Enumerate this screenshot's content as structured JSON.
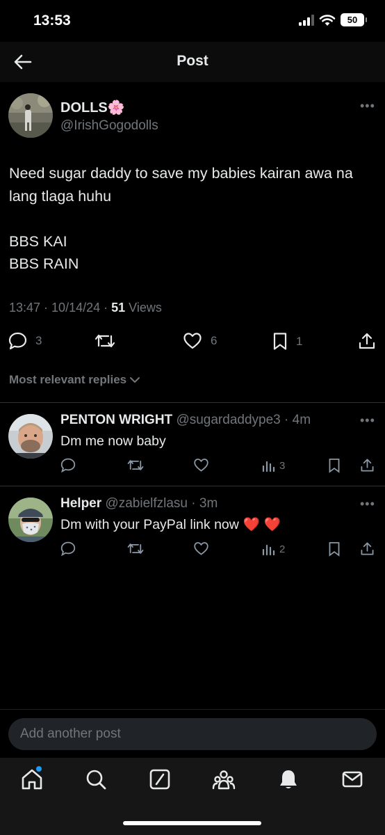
{
  "status_bar": {
    "time": "13:53",
    "battery": "50"
  },
  "header": {
    "title": "Post"
  },
  "post": {
    "author_name": "DOLLS",
    "author_emoji": "🌸",
    "author_handle": "@IrishGogodolls",
    "text": "Need sugar daddy to save my babies kairan awa na lang tlaga huhu\n\nBBS KAI\nBBS RAIN",
    "time": "13:47",
    "date": "10/14/24",
    "views_count": "51",
    "views_label": "Views",
    "replies": "3",
    "likes": "6",
    "bookmarks": "1"
  },
  "replies_sort": {
    "label": "Most relevant replies"
  },
  "replies": [
    {
      "name": "PENTON WRIGHT",
      "handle": "@sugardaddype3",
      "time": "4m",
      "text": "Dm me now baby",
      "views": "3"
    },
    {
      "name": "Helper",
      "handle": "@zabielfzlasu",
      "time": "3m",
      "text": "Dm with your PayPal link now",
      "emoji": "❤️ ❤️",
      "views": "2"
    }
  ],
  "composer": {
    "placeholder": "Add another post"
  },
  "colors": {
    "accent": "#1d9bf0",
    "muted": "#71767b",
    "text": "#e7e9ea",
    "heart": "#e0245e"
  },
  "icons": {
    "back": "arrow-left-icon",
    "tabs": [
      "home-icon",
      "search-icon",
      "grok-icon",
      "communities-icon",
      "notifications-icon",
      "messages-icon"
    ]
  }
}
